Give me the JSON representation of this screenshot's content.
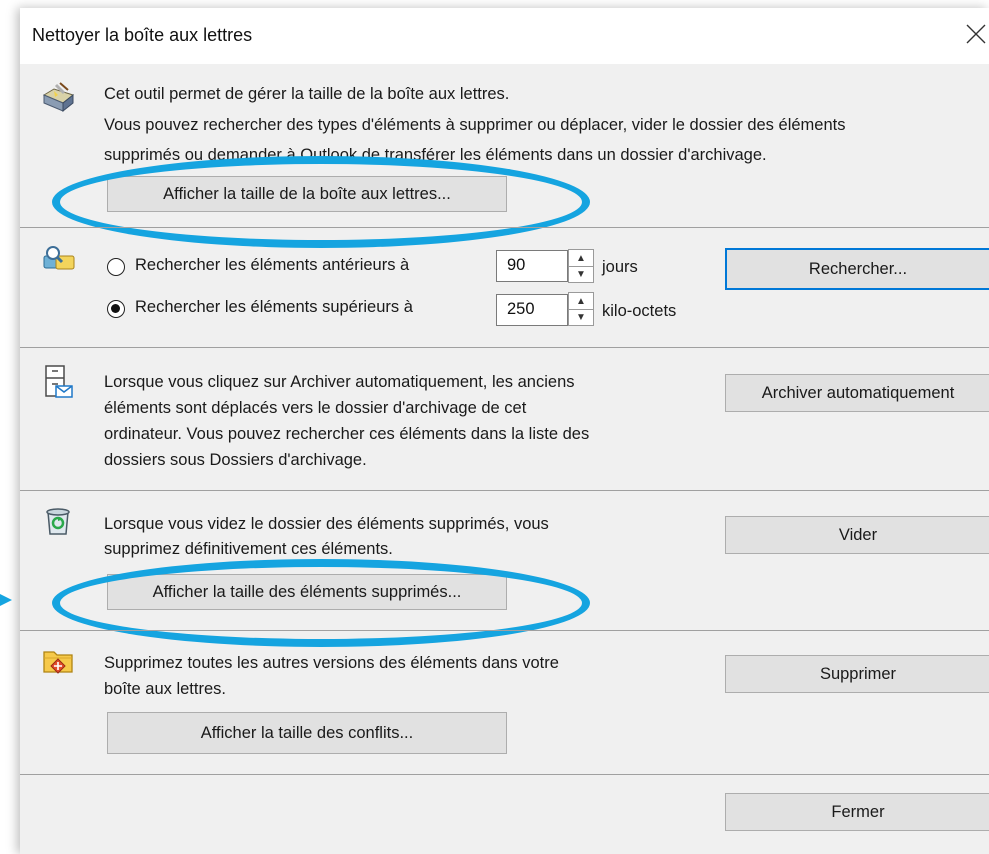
{
  "dialog": {
    "title": "Nettoyer la boîte aux lettres"
  },
  "mailbox_size_section": {
    "icon": "mailbox-cleanup-icon",
    "line1": "Cet outil permet de gérer la taille de la boîte aux lettres.",
    "line2": "Vous pouvez rechercher des types d'éléments à supprimer ou déplacer, vider le dossier des éléments",
    "line3": "supprimés ou demander à Outlook de transférer les éléments dans un dossier d'archivage.",
    "button": "Afficher la taille de la boîte aux lettres..."
  },
  "search_section": {
    "icon": "find-items-icon",
    "option_older_label": "Rechercher les éléments antérieurs à",
    "option_older_value": "90",
    "option_older_unit": "jours",
    "option_larger_label": "Rechercher les éléments supérieurs à",
    "option_larger_value": "250",
    "option_larger_unit": "kilo-octets",
    "selected_option": "larger",
    "button": "Rechercher..."
  },
  "autoarchive_section": {
    "icon": "archive-cabinet-icon",
    "line1": "Lorsque vous cliquez sur Archiver automatiquement, les anciens",
    "line2": "éléments sont déplacés vers le dossier d'archivage de cet",
    "line3": "ordinateur. Vous pouvez rechercher ces éléments dans la liste des",
    "line4": "dossiers sous Dossiers d'archivage.",
    "button": "Archiver automatiquement"
  },
  "deleted_items_section": {
    "icon": "recycle-bin-icon",
    "line1": "Lorsque vous videz le dossier des éléments supprimés, vous",
    "line2": "supprimez définitivement ces éléments.",
    "button_empty": "Vider",
    "button_size": "Afficher la taille des éléments supprimés..."
  },
  "conflicts_section": {
    "icon": "conflicts-folder-icon",
    "line1": "Supprimez toutes les autres versions des éléments dans votre",
    "line2": "boîte aux lettres.",
    "button_delete": "Supprimer",
    "button_size": "Afficher la taille des conflits..."
  },
  "footer": {
    "close_button": "Fermer"
  },
  "colors": {
    "annotation": "#15a4e0",
    "dialog_bg": "#f0f0f0",
    "focus_border": "#0078d7"
  }
}
